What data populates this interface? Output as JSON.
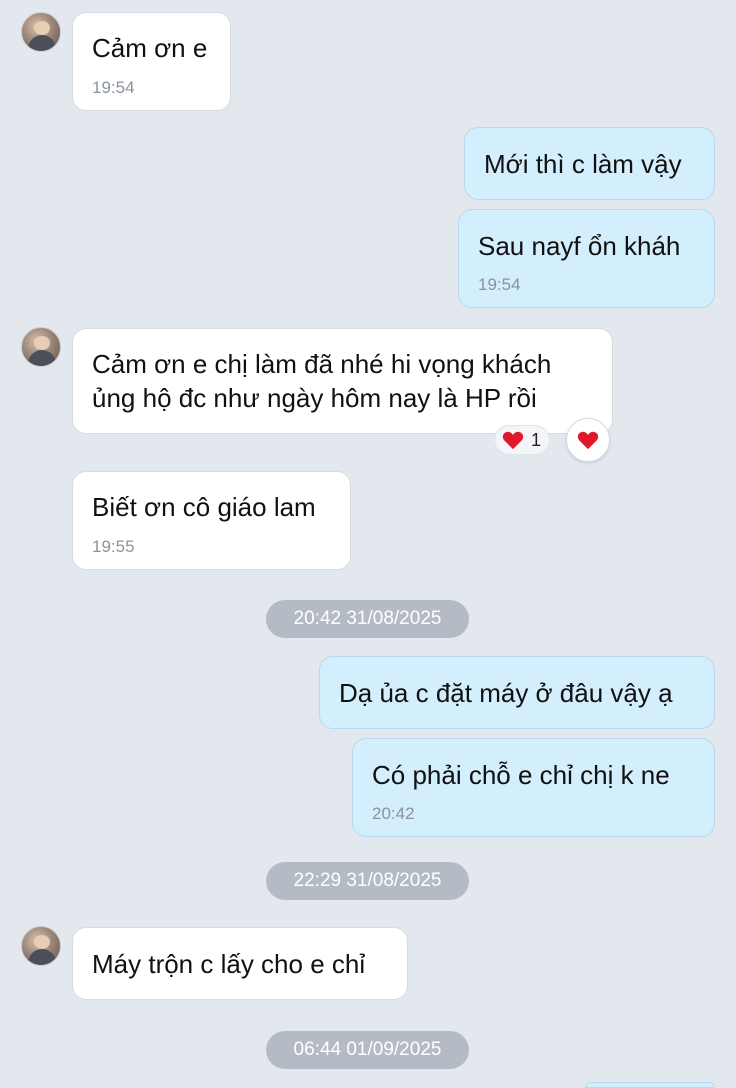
{
  "messages": [
    {
      "text": "Cảm ơn e",
      "time": "19:54",
      "side": "in"
    },
    {
      "text": "Mới thì c làm vậy",
      "side": "out"
    },
    {
      "text": "Sau nayf ổn kháh",
      "time": "19:54",
      "side": "out"
    },
    {
      "lines": [
        "Cảm ơn e chị làm đã nhé hi vọng khách",
        "ủng hộ đc như ngày hôm nay là HP rồi"
      ],
      "side": "in",
      "reaction_count": "1"
    },
    {
      "text": "Biết ơn cô giáo lam",
      "time": "19:55",
      "side": "in"
    },
    {
      "text": "Dạ ủa c đặt máy ở đâu vậy ạ",
      "side": "out"
    },
    {
      "text": "Có phải chỗ e chỉ chị k ne",
      "time": "20:42",
      "side": "out"
    },
    {
      "text": "Máy trộn c lấy cho e chỉ",
      "side": "in"
    }
  ],
  "separators": [
    "20:42 31/08/2025",
    "22:29 31/08/2025",
    "06:44 01/09/2025"
  ],
  "colors": {
    "background": "#e3e7ee",
    "incoming_bubble": "#ffffff",
    "outgoing_bubble": "#d3eefc",
    "date_pill": "#b5bbc4",
    "heart": "#e0182d"
  },
  "icons": {
    "reaction": "heart-icon",
    "avatar": "contact-avatar"
  }
}
